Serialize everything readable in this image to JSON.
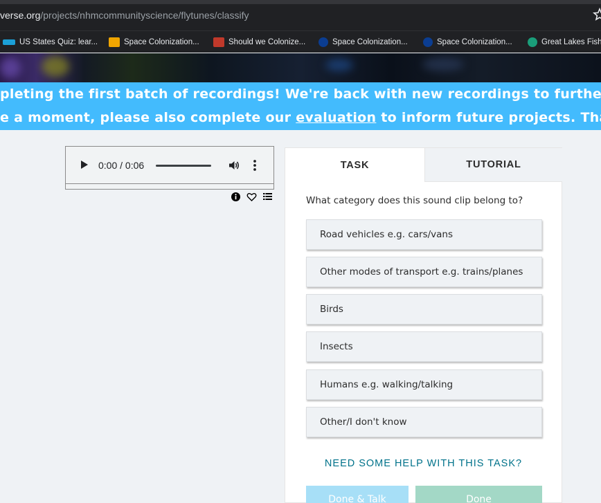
{
  "browser": {
    "url_host": "verse.org",
    "url_path": "/projects/nhmcommunityscience/flytunes/classify",
    "bookmarks": [
      {
        "label": "US States Quiz: lear...",
        "icon": "cisco-icon",
        "color": "#1ba0d7"
      },
      {
        "label": "Space Colonization...",
        "icon": "procon-icon",
        "color": "#f0a500"
      },
      {
        "label": "Should we Colonize...",
        "icon": "page-icon",
        "color": "#c0392b"
      },
      {
        "label": "Space Colonization...",
        "icon": "nasa-icon",
        "color": "#0b3d91"
      },
      {
        "label": "Space Colonization...",
        "icon": "nasa-icon",
        "color": "#0b3d91"
      },
      {
        "label": "Great Lakes Fish",
        "icon": "leaf-icon",
        "color": "#1a9e7a"
      }
    ]
  },
  "banner": {
    "line1": "pleting the first batch of recordings! We're back with new recordings to further refine",
    "line2_before": "e a moment, please also complete our ",
    "line2_link": "evaluation",
    "line2_after": " to inform future projects. Thank you"
  },
  "audio": {
    "time": "0:00 / 0:06"
  },
  "task": {
    "tabs": {
      "task": "TASK",
      "tutorial": "TUTORIAL"
    },
    "question": "What category does this sound clip belong to?",
    "answers": [
      "Road vehicles e.g. cars/vans",
      "Other modes of transport e.g. trains/planes",
      "Birds",
      "Insects",
      "Humans e.g. walking/talking",
      "Other/I don't know"
    ],
    "help": "NEED SOME HELP WITH THIS TASK?",
    "buttons": {
      "done_talk": "Done & Talk",
      "done": "Done"
    }
  },
  "colors": {
    "banner": "#43bbfd",
    "help_link": "#00728a",
    "done_talk": "#a7dff7",
    "done": "#a3d8c6"
  }
}
